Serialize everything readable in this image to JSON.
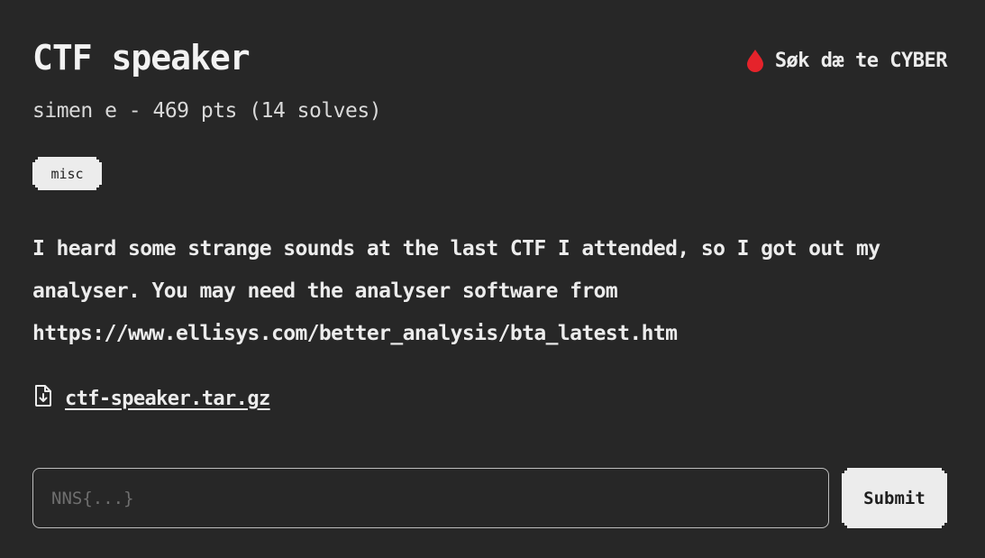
{
  "challenge": {
    "title": "CTF speaker",
    "meta": "simen e - 469 pts (14 solves)",
    "tag": "misc",
    "first_blood": {
      "icon": "blood-drop-icon",
      "color": "#e5232b",
      "label": "Søk dæ te CYBER"
    },
    "description": [
      "I heard some strange sounds at the last CTF I attended, so I got out my",
      "analyser. You may need the analyser software from",
      "https://www.ellisys.com/better_analysis/bta_latest.htm"
    ],
    "attachment": {
      "icon": "file-download-icon",
      "name": "ctf-speaker.tar.gz"
    }
  },
  "flag_form": {
    "placeholder": "NNS{...}",
    "value": "",
    "submit_label": "Submit"
  }
}
